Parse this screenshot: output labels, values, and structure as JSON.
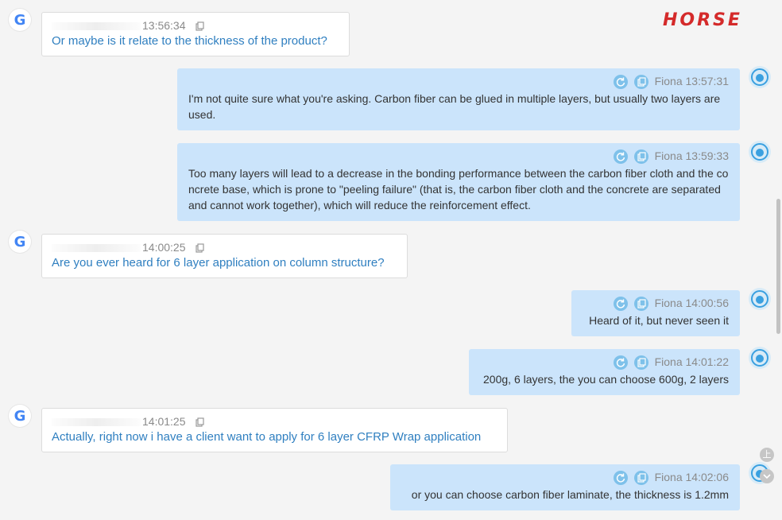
{
  "brand": {
    "logo_text": "HORSE",
    "logo_color": "#d42a2a"
  },
  "messages": [
    {
      "side": "in",
      "sender": "",
      "time": "13:56:34",
      "text": "Or maybe is it relate to the thickness of the product?"
    },
    {
      "side": "out",
      "sender": "Fiona",
      "time": "13:57:31",
      "text": "I'm not quite sure what you're asking. Carbon fiber can be glued in multiple layers, but usually two layers are used."
    },
    {
      "side": "out",
      "sender": "Fiona",
      "time": "13:59:33",
      "text": "Too many layers will lead to a decrease in the bonding performance between the carbon fiber cloth and the concrete base, which is prone to \"peeling failure\" (that is, the carbon fiber cloth and the concrete are separated and cannot work together), which will reduce the reinforcement effect."
    },
    {
      "side": "in",
      "sender": "",
      "time": "14:00:25",
      "text": "Are you ever heard for 6 layer application on column structure?"
    },
    {
      "side": "out",
      "sender": "Fiona",
      "time": "14:00:56",
      "text": "Heard of it, but never seen it"
    },
    {
      "side": "out",
      "sender": "Fiona",
      "time": "14:01:22",
      "text": "200g, 6 layers, the you can choose 600g, 2 layers"
    },
    {
      "side": "in",
      "sender": "",
      "time": "14:01:25",
      "text": "Actually, right now i have a client want to apply for 6 layer CFRP Wrap application"
    },
    {
      "side": "out",
      "sender": "Fiona",
      "time": "14:02:06",
      "text": "or you can choose carbon fiber laminate, the thickness is 1.2mm"
    }
  ],
  "icons": {
    "incoming_avatar": "google-icon",
    "outgoing_avatar": "agent-avatar-icon",
    "resend": "refresh-icon",
    "copy": "copy-icon"
  },
  "colors": {
    "outgoing_bubble": "#cbe4fb",
    "incoming_text": "#2f7fc0",
    "action_icon": "#7ec1ea"
  },
  "controls": {
    "scroll_top_glyph": "上"
  }
}
